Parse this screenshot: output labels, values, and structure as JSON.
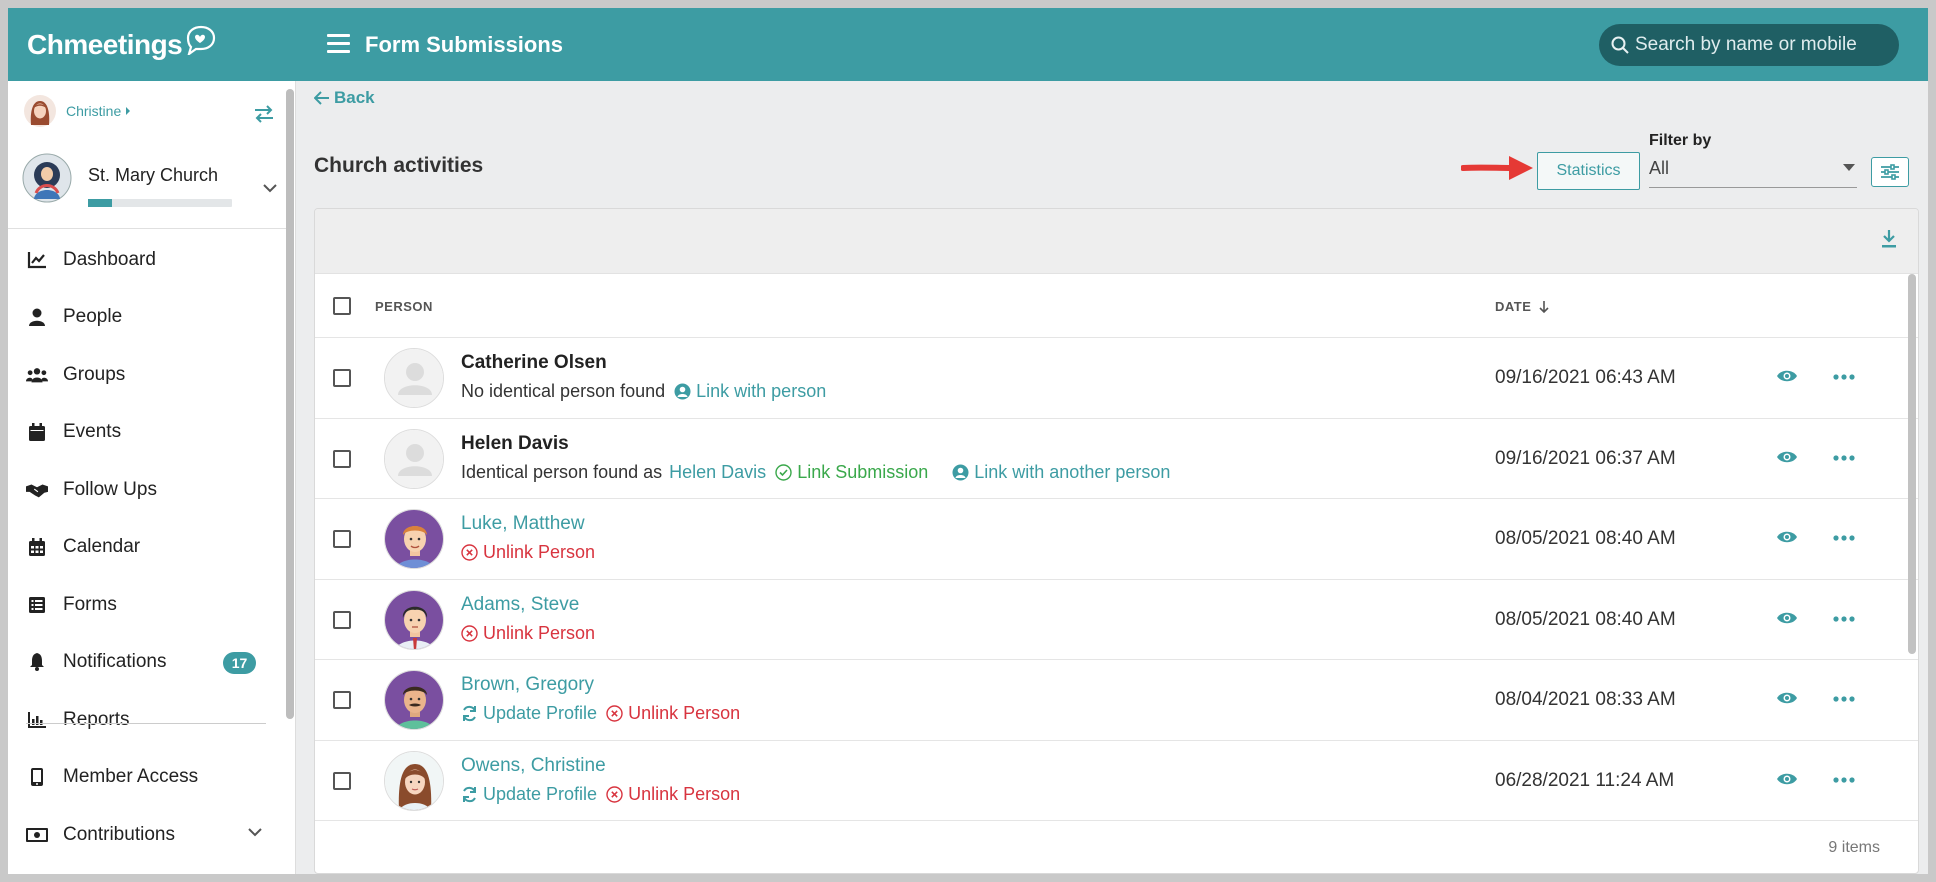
{
  "app": {
    "logo_text": "Chmeetings",
    "page_title": "Form Submissions",
    "search_placeholder": "Search by name or mobile"
  },
  "sidebar": {
    "user_name": "Christine",
    "church_name": "St. Mary Church",
    "church_progress": 0.17,
    "items": [
      {
        "label": "Dashboard",
        "icon": "chart-line-icon"
      },
      {
        "label": "People",
        "icon": "person-icon"
      },
      {
        "label": "Groups",
        "icon": "users-icon"
      },
      {
        "label": "Events",
        "icon": "calendar-icon"
      },
      {
        "label": "Follow Ups",
        "icon": "handshake-icon"
      },
      {
        "label": "Calendar",
        "icon": "calendar-grid-icon"
      },
      {
        "label": "Forms",
        "icon": "list-icon"
      },
      {
        "label": "Notifications",
        "icon": "bell-icon",
        "badge": "17"
      },
      {
        "label": "Reports",
        "icon": "bar-chart-icon"
      },
      {
        "label": "Member Access",
        "icon": "mobile-icon"
      },
      {
        "label": "Contributions",
        "icon": "money-icon"
      }
    ]
  },
  "main": {
    "back_label": "Back",
    "section_title": "Church activities",
    "statistics_label": "Statistics",
    "filter_label": "Filter by",
    "filter_value": "All",
    "table": {
      "col_person": "PERSON",
      "col_date": "DATE",
      "rows": [
        {
          "name": "Catherine Olsen",
          "status_text": "No identical person found",
          "link_with_person": "Link with person",
          "date": "09/16/2021 06:43 AM"
        },
        {
          "name": "Helen Davis",
          "status_text": "Identical person found as",
          "match_name": "Helen Davis",
          "link_submission": "Link Submission",
          "link_another": "Link with another person",
          "date": "09/16/2021 06:37 AM"
        },
        {
          "name": "Luke, Matthew",
          "unlink": "Unlink Person",
          "date": "08/05/2021 08:40 AM"
        },
        {
          "name": "Adams, Steve",
          "unlink": "Unlink Person",
          "date": "08/05/2021 08:40 AM"
        },
        {
          "name": "Brown, Gregory",
          "update": "Update Profile",
          "unlink": "Unlink Person",
          "date": "08/04/2021 08:33 AM"
        },
        {
          "name": "Owens, Christine",
          "update": "Update Profile",
          "unlink": "Unlink Person",
          "date": "06/28/2021 11:24 AM"
        }
      ],
      "items_count": "9 items"
    }
  },
  "colors": {
    "primary": "#3d9ca3",
    "danger": "#d8343f",
    "success": "#3aa84b",
    "annotation_arrow": "#e53935"
  }
}
